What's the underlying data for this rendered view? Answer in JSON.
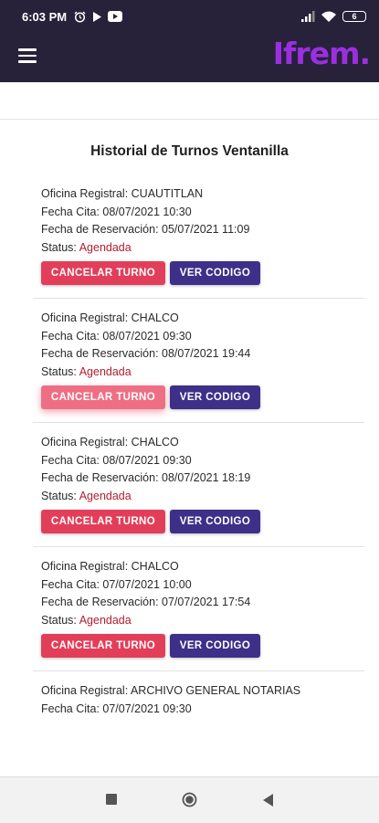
{
  "status_bar": {
    "time": "6:03 PM",
    "battery": "6",
    "icons": [
      "alarm-icon",
      "app-notification-icon",
      "youtube-icon",
      "signal-icon",
      "wifi-icon",
      "battery-icon"
    ]
  },
  "app_bar": {
    "menu_icon": "hamburger-menu-icon",
    "logo_text": "Ifrem.",
    "background": "#27213a",
    "logo_color": "#9b2fe0"
  },
  "page": {
    "title": "Historial de Turnos Ventanilla"
  },
  "labels": {
    "oficina": "Oficina Registral: ",
    "fecha_cita": "Fecha Cita: ",
    "fecha_reservacion": "Fecha de Reservación: ",
    "status": "Status: "
  },
  "buttons": {
    "cancel": "CANCELAR TURNO",
    "code": "VER CODIGO",
    "cancel_color": "#e23e5a",
    "code_color": "#3e2f88"
  },
  "status_color": "#b01e2e",
  "appointments": [
    {
      "oficina": "CUAUTITLAN",
      "fecha_cita": "08/07/2021 10:30",
      "fecha_reservacion": "05/07/2021 11:09",
      "status": "Agendada"
    },
    {
      "oficina": "CHALCO",
      "fecha_cita": "08/07/2021 09:30",
      "fecha_reservacion": "08/07/2021 19:44",
      "status": "Agendada"
    },
    {
      "oficina": "CHALCO",
      "fecha_cita": "08/07/2021 09:30",
      "fecha_reservacion": "08/07/2021 18:19",
      "status": "Agendada"
    },
    {
      "oficina": "CHALCO",
      "fecha_cita": "07/07/2021 10:00",
      "fecha_reservacion": "07/07/2021 17:54",
      "status": "Agendada"
    },
    {
      "oficina": "ARCHIVO GENERAL NOTARIAS",
      "fecha_cita": "07/07/2021 09:30",
      "fecha_reservacion": "",
      "status": ""
    }
  ],
  "nav_bar": {
    "icons": [
      "recent-apps-icon",
      "home-icon",
      "back-icon"
    ]
  }
}
